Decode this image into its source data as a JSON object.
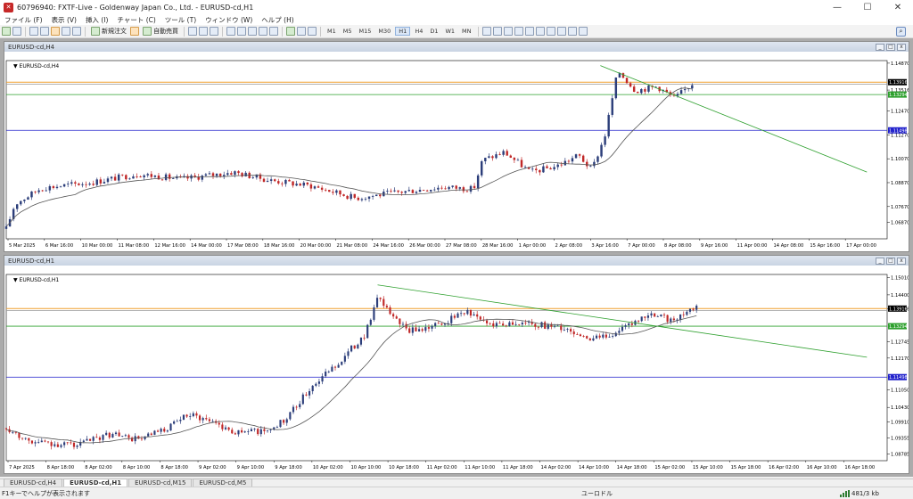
{
  "window": {
    "title": "60796940: FXTF-Live - Goldenway Japan Co., Ltd. - EURUSD-cd,H1",
    "minimize": "—",
    "maximize": "☐",
    "close": "✕",
    "icon": "app-logo-icon"
  },
  "menu": [
    "ファイル (F)",
    "表示 (V)",
    "挿入 (I)",
    "チャート (C)",
    "ツール (T)",
    "ウィンドウ (W)",
    "ヘルプ (H)"
  ],
  "toolbar": {
    "new_order": "新規注文",
    "auto_trading": "自動売買",
    "timeframes": [
      "M1",
      "M5",
      "M15",
      "M30",
      "H1",
      "H4",
      "D1",
      "W1",
      "MN"
    ],
    "active_timeframe": "H1"
  },
  "charts": [
    {
      "window_title": "EURUSD-cd,H4",
      "label": "EURUSD-cd,H4",
      "chart_data": {
        "type": "candlestick",
        "symbol": "EURUSD-cd",
        "timeframe": "H4",
        "ylim": [
          1.0605,
          1.15
        ],
        "y_ticks": [
          "1.14870",
          "1.13516",
          "1.12470",
          "1.11270",
          "1.10070",
          "1.08870",
          "1.07670",
          "1.06870"
        ],
        "y_tick_values": [
          1.1487,
          1.1352,
          1.1247,
          1.1127,
          1.1007,
          1.0887,
          1.0767,
          1.0687
        ],
        "x_labels": [
          "5 Mar 2025",
          "6 Mar 16:00",
          "10 Mar 00:00",
          "11 Mar 08:00",
          "12 Mar 16:00",
          "14 Mar 00:00",
          "17 Mar 08:00",
          "18 Mar 16:00",
          "20 Mar 00:00",
          "21 Mar 08:00",
          "24 Mar 16:00",
          "26 Mar 00:00",
          "27 Mar 08:00",
          "28 Mar 16:00",
          "1 Apr 00:00",
          "2 Apr 08:00",
          "3 Apr 16:00",
          "7 Apr 00:00",
          "8 Apr 08:00",
          "9 Apr 16:00",
          "11 Apr 00:00",
          "14 Apr 08:00",
          "15 Apr 16:00",
          "17 Apr 00:00"
        ],
        "price_tag": "1.13916",
        "green_tag": "1.13294",
        "blue_tag": "1.11498",
        "levels": {
          "orange": 1.13916,
          "gray": 1.1382,
          "green": 1.13294,
          "blue": 1.11498
        },
        "trend": {
          "from": [
            0.68,
            1.1475
          ],
          "to": [
            0.985,
            1.094
          ]
        },
        "anchors": [
          [
            0,
            1.0655
          ],
          [
            0.01,
            1.078
          ],
          [
            0.04,
            1.086
          ],
          [
            0.1,
            1.089
          ],
          [
            0.15,
            1.093
          ],
          [
            0.2,
            1.0905
          ],
          [
            0.26,
            1.094
          ],
          [
            0.3,
            1.09
          ],
          [
            0.35,
            1.087
          ],
          [
            0.4,
            1.081
          ],
          [
            0.45,
            1.084
          ],
          [
            0.5,
            1.0865
          ],
          [
            0.535,
            1.0855
          ],
          [
            0.545,
            1.1
          ],
          [
            0.57,
            1.104
          ],
          [
            0.6,
            1.094
          ],
          [
            0.63,
            1.097
          ],
          [
            0.655,
            1.1025
          ],
          [
            0.67,
            1.095
          ],
          [
            0.685,
            1.112
          ],
          [
            0.7,
            1.145
          ],
          [
            0.72,
            1.135
          ],
          [
            0.745,
            1.137
          ],
          [
            0.765,
            1.131
          ],
          [
            0.785,
            1.1385
          ]
        ],
        "colors": {
          "up": "#2c3e7a",
          "down": "#c02828",
          "ma": "#555555",
          "trend": "#2ea02e"
        }
      }
    },
    {
      "window_title": "EURUSD-cd,H1",
      "label": "EURUSD-cd,H1",
      "chart_data": {
        "type": "candlestick",
        "symbol": "EURUSD-cd",
        "timeframe": "H1",
        "ylim": [
          1.0855,
          1.1512
        ],
        "y_ticks": [
          "1.15010",
          "1.14400",
          "1.13916",
          "1.12745",
          "1.12170",
          "1.11050",
          "1.10430",
          "1.09910",
          "1.09355",
          "1.08785"
        ],
        "y_tick_values": [
          1.1501,
          1.144,
          1.13916,
          1.12745,
          1.1217,
          1.1105,
          1.1043,
          1.0991,
          1.09355,
          1.08785
        ],
        "x_labels": [
          "7 Apr 2025",
          "8 Apr 18:00",
          "8 Apr 02:00",
          "8 Apr 10:00",
          "8 Apr 18:00",
          "9 Apr 02:00",
          "9 Apr 10:00",
          "9 Apr 18:00",
          "10 Apr 02:00",
          "10 Apr 10:00",
          "10 Apr 18:00",
          "11 Apr 02:00",
          "11 Apr 10:00",
          "11 Apr 18:00",
          "14 Apr 02:00",
          "14 Apr 10:00",
          "14 Apr 18:00",
          "15 Apr 02:00",
          "15 Apr 10:00",
          "15 Apr 18:00",
          "16 Apr 02:00",
          "16 Apr 10:00",
          "16 Apr 18:00"
        ],
        "price_tag": "1.13916",
        "green_tag": "1.13294",
        "blue_tag": "1.11498",
        "levels": {
          "orange": 1.13916,
          "gray": 1.1385,
          "green": 1.13294,
          "blue": 1.11498
        },
        "trend": {
          "from": [
            0.425,
            1.1475
          ],
          "to": [
            0.985,
            1.122
          ]
        },
        "anchors": [
          [
            0,
            1.097
          ],
          [
            0.03,
            1.092
          ],
          [
            0.08,
            1.091
          ],
          [
            0.12,
            1.095
          ],
          [
            0.15,
            1.093
          ],
          [
            0.18,
            1.096
          ],
          [
            0.21,
            1.102
          ],
          [
            0.24,
            1.099
          ],
          [
            0.26,
            1.0955
          ],
          [
            0.3,
            1.0962
          ],
          [
            0.32,
            1.1
          ],
          [
            0.35,
            1.112
          ],
          [
            0.38,
            1.12
          ],
          [
            0.41,
            1.13
          ],
          [
            0.425,
            1.1425
          ],
          [
            0.46,
            1.131
          ],
          [
            0.5,
            1.134
          ],
          [
            0.525,
            1.1385
          ],
          [
            0.55,
            1.134
          ],
          [
            0.6,
            1.134
          ],
          [
            0.64,
            1.132
          ],
          [
            0.67,
            1.128
          ],
          [
            0.7,
            1.131
          ],
          [
            0.74,
            1.1375
          ],
          [
            0.76,
            1.135
          ],
          [
            0.79,
            1.1395
          ]
        ],
        "colors": {
          "up": "#2c3e7a",
          "down": "#c02828",
          "ma": "#555555",
          "trend": "#2ea02e"
        }
      }
    }
  ],
  "tabs": [
    "EURUSD-cd,H4",
    "EURUSD-cd,H1",
    "EURUSD-cd,M15",
    "EURUSD-cd,M5"
  ],
  "active_tab": "EURUSD-cd,H1",
  "status": {
    "hint": "F1キーでヘルプが表示されます",
    "profile": "ユーロドル",
    "traffic": "481/3 kb"
  }
}
